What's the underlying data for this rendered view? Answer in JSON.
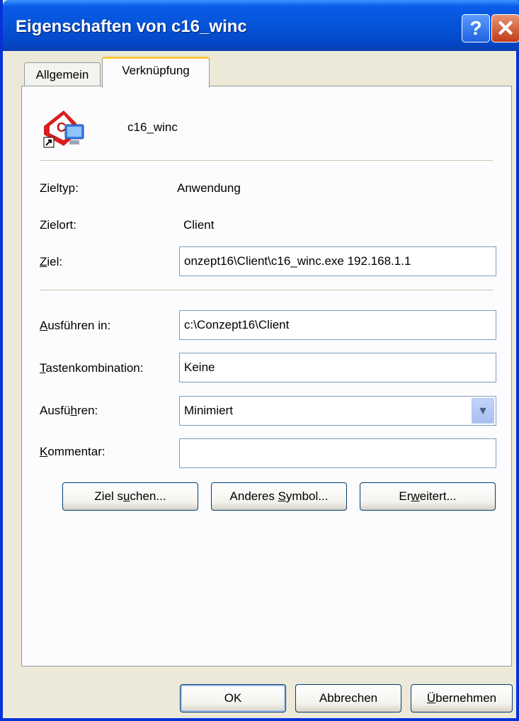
{
  "window": {
    "title": "Eigenschaften von c16_winc",
    "help_glyph": "?",
    "close_glyph": "✕"
  },
  "tabs": [
    {
      "label": "Allgemein",
      "active": false
    },
    {
      "label": "Verknüpfung",
      "active": true
    }
  ],
  "shortcut": {
    "name": "c16_winc",
    "icon": "application-shortcut-icon"
  },
  "details": {
    "zieltyp_label": "Zieltyp:",
    "zieltyp_value": "Anwendung",
    "zielort_label": "Zielort:",
    "zielort_value": "Client"
  },
  "fields": {
    "ziel": {
      "label_pre": "",
      "label_ul": "Z",
      "label_post": "iel:",
      "value": "onzept16\\Client\\c16_winc.exe 192.168.1.1"
    },
    "ausfuehren_in": {
      "label_pre": "",
      "label_ul": "A",
      "label_post": "usführen in:",
      "value": "c:\\Conzept16\\Client"
    },
    "tastenkombination": {
      "label_pre": "",
      "label_ul": "T",
      "label_post": "astenkombination:",
      "value": "Keine"
    },
    "ausfuehren": {
      "label_pre": "Ausfü",
      "label_ul": "h",
      "label_post": "ren:",
      "value": "Minimiert"
    },
    "kommentar": {
      "label_pre": "",
      "label_ul": "K",
      "label_post": "ommentar:",
      "value": ""
    }
  },
  "buttons": {
    "ziel_suchen": {
      "pre": "Ziel s",
      "ul": "u",
      "post": "chen..."
    },
    "anderes_symbol": {
      "pre": "Anderes ",
      "ul": "S",
      "post": "ymbol..."
    },
    "erweitert": {
      "pre": "Er",
      "ul": "w",
      "post": "eitert..."
    },
    "ok": "OK",
    "abbrechen": "Abbrechen",
    "uebernehmen": {
      "pre": "",
      "ul": "Ü",
      "post": "bernehmen"
    }
  },
  "colors": {
    "titlebar": "#0553d8",
    "tab_highlight": "#ffc83c",
    "dialog_bg": "#ece9d8"
  }
}
